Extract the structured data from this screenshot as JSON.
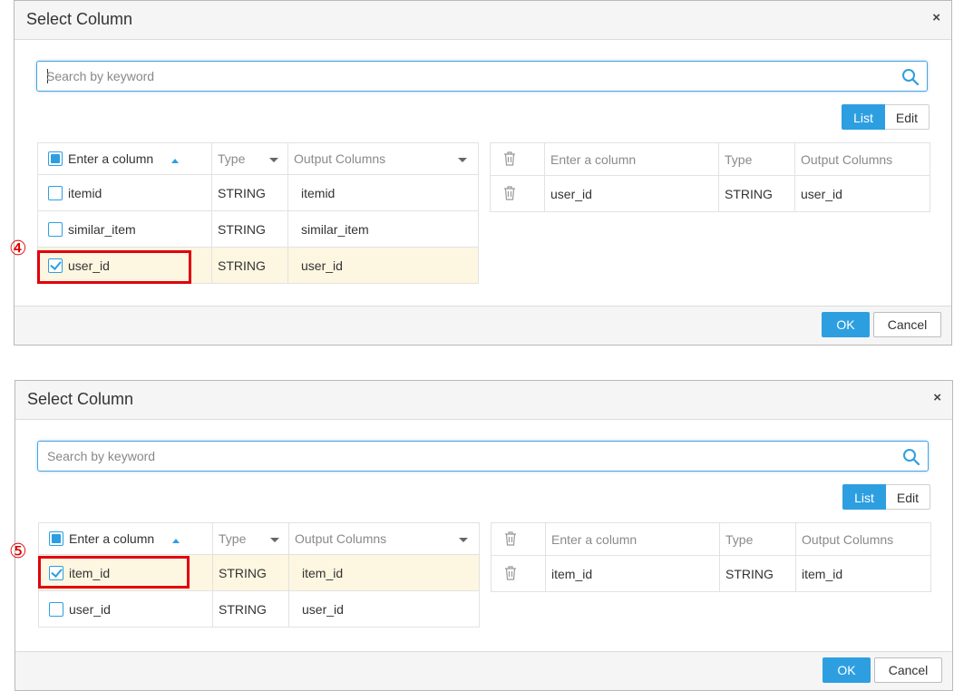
{
  "dialogs": [
    {
      "title": "Select Column",
      "close_label": "×",
      "search": {
        "placeholder": "Search by keyword",
        "value": ""
      },
      "view_toggle": {
        "list_label": "List",
        "edit_label": "Edit",
        "active": "List"
      },
      "left_table": {
        "headers": [
          "Enter a column",
          "Type",
          "Output Columns"
        ],
        "rows": [
          {
            "name": "itemid",
            "type": "STRING",
            "output": "itemid",
            "checked": false
          },
          {
            "name": "similar_item",
            "type": "STRING",
            "output": "similar_item",
            "checked": false
          },
          {
            "name": "user_id",
            "type": "STRING",
            "output": "user_id",
            "checked": true
          }
        ]
      },
      "right_table": {
        "headers": [
          "Enter a column",
          "Type",
          "Output Columns"
        ],
        "rows": [
          {
            "name": "user_id",
            "type": "STRING",
            "output": "user_id"
          }
        ]
      },
      "ok_label": "OK",
      "cancel_label": "Cancel",
      "step_marker": "④"
    },
    {
      "title": "Select Column",
      "close_label": "×",
      "search": {
        "placeholder": "Search by keyword",
        "value": ""
      },
      "view_toggle": {
        "list_label": "List",
        "edit_label": "Edit",
        "active": "List"
      },
      "left_table": {
        "headers": [
          "Enter a column",
          "Type",
          "Output Columns"
        ],
        "rows": [
          {
            "name": "item_id",
            "type": "STRING",
            "output": "item_id",
            "checked": true
          },
          {
            "name": "user_id",
            "type": "STRING",
            "output": "user_id",
            "checked": false
          }
        ]
      },
      "right_table": {
        "headers": [
          "Enter a column",
          "Type",
          "Output Columns"
        ],
        "rows": [
          {
            "name": "item_id",
            "type": "STRING",
            "output": "item_id"
          }
        ]
      },
      "ok_label": "OK",
      "cancel_label": "Cancel",
      "step_marker": "⑤"
    }
  ],
  "colors": {
    "accent": "#2d9fe0",
    "highlight_row": "#fdf6e1",
    "annotation_red": "#e0000e"
  },
  "icons": {
    "search": "search-icon",
    "close": "close-icon",
    "delete": "trash-icon",
    "sort": "sort-ascending-icon",
    "dropdown": "chevron-down-icon"
  }
}
